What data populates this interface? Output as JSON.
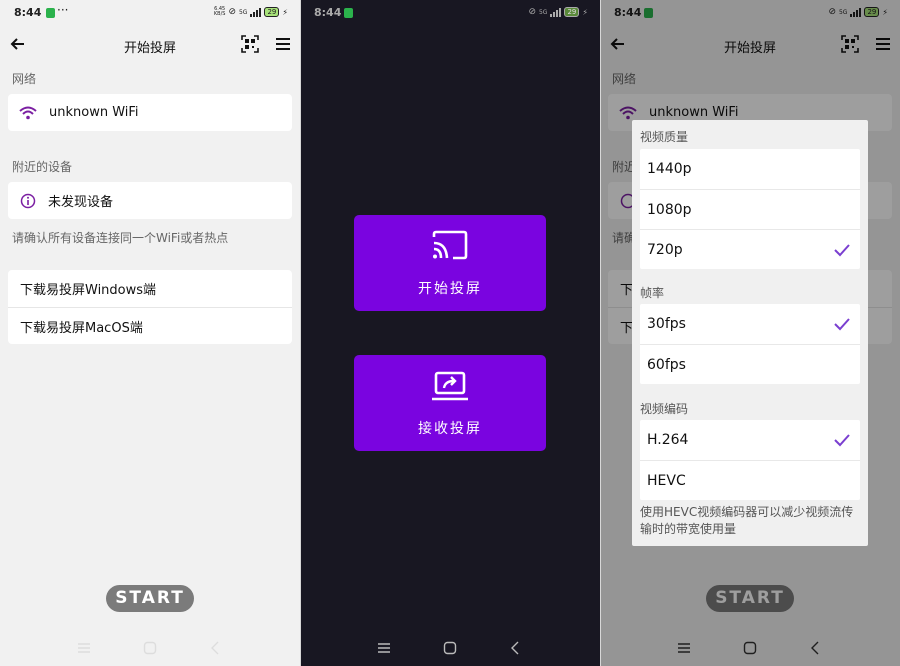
{
  "colors": {
    "accent": "#7a04e0",
    "wifi_icon": "#7b1fa2",
    "check": "#7a3fd0",
    "page_bg": "#f1f1f1",
    "dark_bg": "#181722"
  },
  "status_bar": {
    "time": "8:44",
    "dots": "···",
    "speed_top": "6.45",
    "speed_unit": "KB/S",
    "network": "5G",
    "battery": "29",
    "battery_dark": "29"
  },
  "screen1": {
    "title": "开始投屏",
    "network_section": "网络",
    "wifi_label": "unknown WiFi",
    "devices_section": "附近的设备",
    "no_device_label": "未发现设备",
    "hint": "请确认所有设备连接同一个WiFi或者热点",
    "links": [
      "下载易投屏Windows端",
      "下载易投屏MacOS端"
    ],
    "start_label": "START"
  },
  "screen2": {
    "cast_label": "开始投屏",
    "receive_label": "接收投屏",
    "cast_icon": "cast-icon",
    "receive_icon": "laptop-share-icon"
  },
  "screen3": {
    "title": "开始投屏",
    "network_section": "网络",
    "wifi_label": "unknown WiFi",
    "devices_section_partial": "附近",
    "hint_partial": "请确",
    "link_partial": [
      "下",
      "下"
    ],
    "start_label": "START",
    "sheet": {
      "quality_title": "视频质量",
      "quality_options": [
        "1440p",
        "1080p",
        "720p"
      ],
      "quality_selected": "720p",
      "fps_title": "帧率",
      "fps_options": [
        "30fps",
        "60fps"
      ],
      "fps_selected": "30fps",
      "codec_title": "视频编码",
      "codec_options": [
        "H.264",
        "HEVC"
      ],
      "codec_selected": "H.264",
      "note": "使用HEVC视频编码器可以减少视频流传输时的带宽使用量"
    }
  }
}
